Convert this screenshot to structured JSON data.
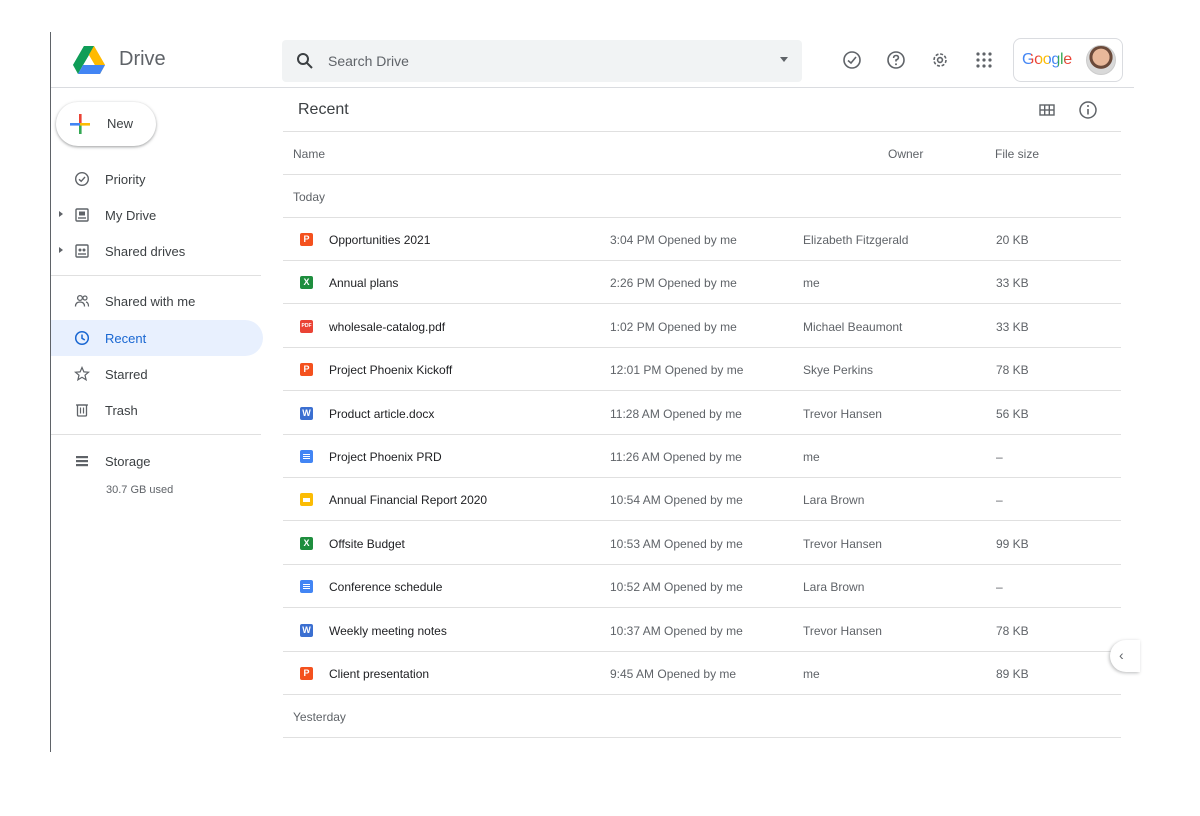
{
  "header": {
    "brand": "Drive",
    "search_placeholder": "Search Drive",
    "google_label": "Google"
  },
  "sidebar": {
    "new_label": "New",
    "items": [
      {
        "label": "Priority"
      },
      {
        "label": "My Drive"
      },
      {
        "label": "Shared drives"
      },
      {
        "label": "Shared with me"
      },
      {
        "label": "Recent"
      },
      {
        "label": "Starred"
      },
      {
        "label": "Trash"
      },
      {
        "label": "Storage"
      }
    ],
    "storage_used": "30.7 GB used",
    "active_item": "Recent"
  },
  "main": {
    "title": "Recent",
    "columns": {
      "name": "Name",
      "owner": "Owner",
      "size": "File size"
    },
    "groups": [
      "Today",
      "Yesterday"
    ],
    "rows": [
      {
        "name": "Opportunities 2021",
        "opened": "3:04 PM Opened by me",
        "owner": "Elizabeth Fitzgerald",
        "size": "20 KB",
        "type": "slides-orange"
      },
      {
        "name": "Annual plans",
        "opened": "2:26 PM Opened by me",
        "owner": "me",
        "size": "33 KB",
        "type": "excel"
      },
      {
        "name": "wholesale-catalog.pdf",
        "opened": "1:02 PM Opened by me",
        "owner": "Michael Beaumont",
        "size": "33 KB",
        "type": "pdf"
      },
      {
        "name": "Project Phoenix Kickoff",
        "opened": "12:01 PM Opened by me",
        "owner": "Skye Perkins",
        "size": "78 KB",
        "type": "slides-orange"
      },
      {
        "name": "Product article.docx",
        "opened": "11:28 AM Opened by me",
        "owner": "Trevor Hansen",
        "size": "56 KB",
        "type": "word"
      },
      {
        "name": "Project Phoenix PRD",
        "opened": "11:26 AM Opened by me",
        "owner": "me",
        "size": "–",
        "type": "docs"
      },
      {
        "name": "Annual Financial Report 2020",
        "opened": "10:54 AM Opened by me",
        "owner": "Lara Brown",
        "size": "–",
        "type": "slides-yellow"
      },
      {
        "name": "Offsite Budget",
        "opened": "10:53 AM Opened by me",
        "owner": "Trevor Hansen",
        "size": "99 KB",
        "type": "excel"
      },
      {
        "name": "Conference schedule",
        "opened": "10:52 AM Opened by me",
        "owner": "Lara Brown",
        "size": "–",
        "type": "docs"
      },
      {
        "name": "Weekly meeting notes",
        "opened": "10:37 AM Opened by me",
        "owner": "Trevor Hansen",
        "size": "78 KB",
        "type": "word"
      },
      {
        "name": "Client presentation",
        "opened": "9:45 AM Opened by me",
        "owner": "me",
        "size": "89 KB",
        "type": "slides-orange"
      }
    ]
  },
  "colors": {
    "accent": "#1967d2",
    "active_bg": "#e8f0fe",
    "slides": "#f4511e",
    "slides_yellow": "#fbbc04",
    "sheets": "#1e8e3e",
    "docs": "#4285f4",
    "pdf": "#ea4335",
    "word": "#3b6fd1"
  }
}
